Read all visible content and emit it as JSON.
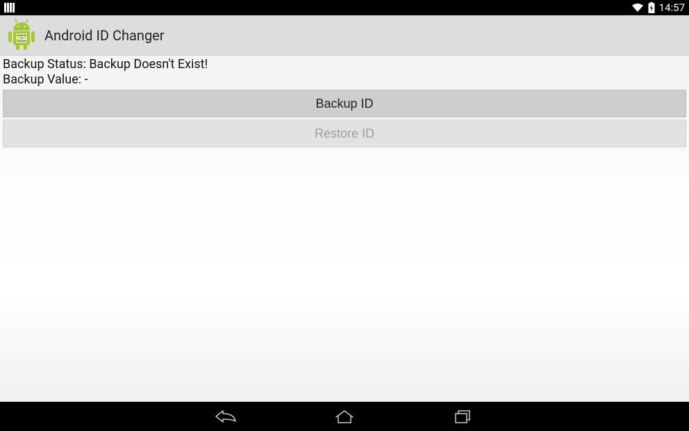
{
  "statusBar": {
    "time": "14:57"
  },
  "actionBar": {
    "title": "Android ID Changer",
    "iconLabel": "Android ID Changer"
  },
  "content": {
    "backupStatusLabel": "Backup Status: ",
    "backupStatusValue": "Backup Doesn't Exist!",
    "backupValueLabel": "Backup Value: ",
    "backupValueValue": "-",
    "backupButton": "Backup ID",
    "restoreButton": "Restore ID"
  }
}
